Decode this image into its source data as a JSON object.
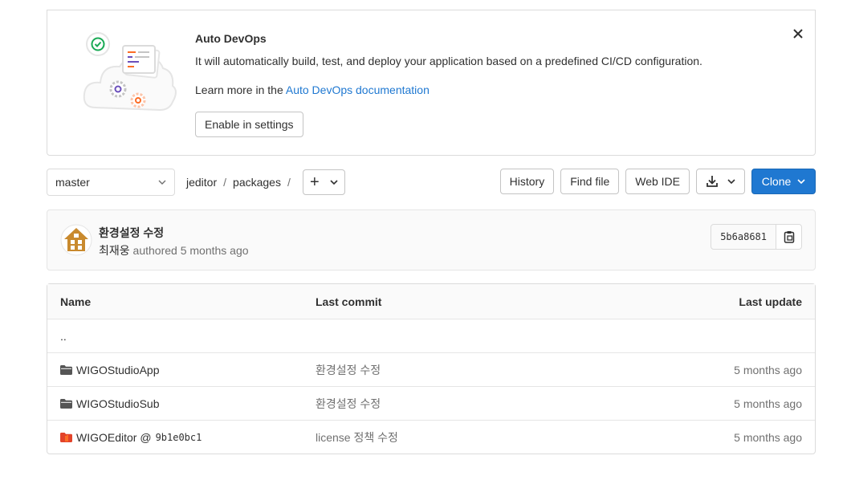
{
  "banner": {
    "title": "Auto DevOps",
    "description": "It will automatically build, test, and deploy your application based on a predefined CI/CD configuration.",
    "learn_prefix": "Learn more in the ",
    "learn_link": "Auto DevOps documentation",
    "enable_button": "Enable in settings",
    "close_icon": "close-icon"
  },
  "toolbar": {
    "branch": "master",
    "breadcrumb": [
      "jeditor",
      "packages"
    ],
    "add_label": "+",
    "history": "History",
    "find_file": "Find file",
    "web_ide": "Web IDE",
    "clone": "Clone"
  },
  "commit": {
    "title": "환경설정 수정",
    "author": "최재웅",
    "authored_text": "authored 5 months ago",
    "sha": "5b6a8681"
  },
  "table": {
    "headers": {
      "name": "Name",
      "last_commit": "Last commit",
      "last_update": "Last update"
    },
    "parent": "..",
    "rows": [
      {
        "name": "WIGOStudioApp",
        "commit": "환경설정 수정",
        "updated": "5 months ago",
        "icon": "folder-icon"
      },
      {
        "name": "WIGOStudioSub",
        "commit": "환경설정 수정",
        "updated": "5 months ago",
        "icon": "folder-icon"
      },
      {
        "name": "WIGOEditor @",
        "sha": "9b1e0bc1",
        "commit": "license 정책 수정",
        "updated": "5 months ago",
        "icon": "submodule-icon"
      }
    ]
  },
  "colors": {
    "accent": "#1f78d1",
    "border": "#dbdbdb",
    "submodule": "#e2432a"
  }
}
